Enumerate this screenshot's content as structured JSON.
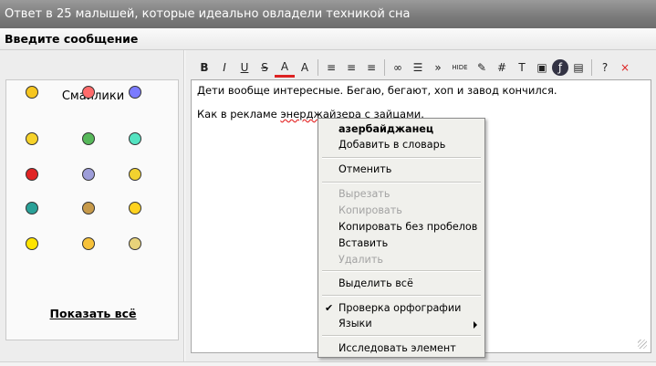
{
  "title": "Ответ в 25 малышей, которые идеально овладели техникой сна",
  "subtitle": "Введите сообщение",
  "smilies": {
    "heading": "Смайлики",
    "show_all": "Показать всё",
    "items": [
      {
        "icon": "smile-icon",
        "color": "#f6c620"
      },
      {
        "icon": "love-icon",
        "color": "#ff6b6b"
      },
      {
        "icon": "sad-icon",
        "color": "#7b7bff"
      },
      {
        "icon": "thumbs-up-icon",
        "color": "#f6d22a"
      },
      {
        "icon": "gun-icon",
        "color": "#57b85a"
      },
      {
        "icon": "neutral-icon",
        "color": "#54e3c1"
      },
      {
        "icon": "shooter-icon",
        "color": "#e02424"
      },
      {
        "icon": "dance-icon",
        "color": "#9d9dd9"
      },
      {
        "icon": "wave-icon",
        "color": "#f2d22f"
      },
      {
        "icon": "ninja-icon",
        "color": "#2aa198"
      },
      {
        "icon": "bread-icon",
        "color": "#c79a4a"
      },
      {
        "icon": "cheer-icon",
        "color": "#ffd21f"
      },
      {
        "icon": "jump-icon",
        "color": "#ffe400"
      },
      {
        "icon": "laugh-icon",
        "color": "#f7c23a"
      },
      {
        "icon": "star-icon",
        "color": "#e8d37a"
      }
    ]
  },
  "toolbar": {
    "items": [
      {
        "icon": "bold-icon",
        "glyph": "B"
      },
      {
        "icon": "italic-icon",
        "glyph": "I"
      },
      {
        "icon": "underline-icon",
        "glyph": "U"
      },
      {
        "icon": "strikethrough-icon",
        "glyph": "S"
      },
      {
        "icon": "font-color-icon",
        "glyph": "A"
      },
      {
        "icon": "font-size-icon",
        "glyph": "A"
      },
      {
        "icon": "align-left-icon",
        "glyph": "≡"
      },
      {
        "icon": "align-center-icon",
        "glyph": "≡"
      },
      {
        "icon": "align-right-icon",
        "glyph": "≡"
      },
      {
        "icon": "link-icon",
        "glyph": "∞"
      },
      {
        "icon": "list-icon",
        "glyph": "☰"
      },
      {
        "icon": "quote-icon",
        "glyph": "»"
      },
      {
        "icon": "hide-icon",
        "glyph": "HIDE"
      },
      {
        "icon": "edit-icon",
        "glyph": "✎"
      },
      {
        "icon": "hash-icon",
        "glyph": "#"
      },
      {
        "icon": "text-icon",
        "glyph": "T"
      },
      {
        "icon": "image-icon",
        "glyph": "▣"
      },
      {
        "icon": "flash-icon",
        "glyph": "ƒ"
      },
      {
        "icon": "video-icon",
        "glyph": "▤"
      },
      {
        "icon": "help-icon",
        "glyph": "?"
      },
      {
        "icon": "close-icon",
        "glyph": "×"
      }
    ]
  },
  "editor": {
    "line1": "Дети вообще интересные. Бегаю, бегают, хоп и завод кончился.",
    "line2_before": "Как в рекламе ",
    "line2_misspelled": "энерджайзера",
    "line2_after": " с зайцами."
  },
  "context_menu": {
    "suggestion": "азербайджанец",
    "add_to_dictionary": "Добавить в словарь",
    "undo": "Отменить",
    "cut": "Вырезать",
    "copy": "Копировать",
    "copy_no_spaces": "Копировать без пробелов",
    "paste": "Вставить",
    "delete": "Удалить",
    "select_all": "Выделить всё",
    "spellcheck": "Проверка орфографии",
    "languages": "Языки",
    "inspect": "Исследовать элемент"
  }
}
